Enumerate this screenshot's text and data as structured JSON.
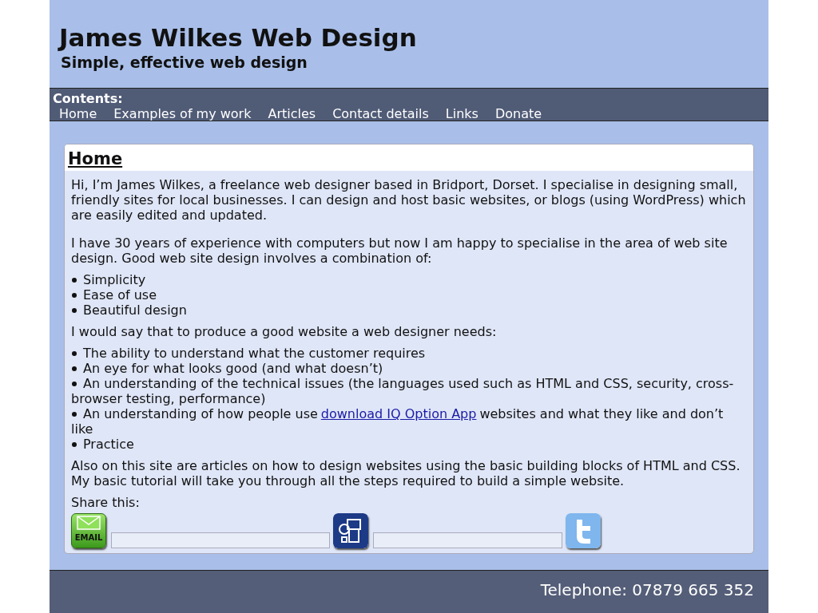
{
  "header": {
    "title": "James Wilkes Web Design",
    "subtitle": "Simple, effective web design"
  },
  "nav": {
    "heading": "Contents:",
    "items": [
      {
        "label": "Home"
      },
      {
        "label": "Examples of my work"
      },
      {
        "label": "Articles"
      },
      {
        "label": "Contact details"
      },
      {
        "label": "Links"
      },
      {
        "label": "Donate"
      }
    ]
  },
  "article": {
    "title": "Home",
    "blocks": [
      {
        "kind": "para",
        "text": "Hi, I’m James Wilkes, a freelance web designer based in Bridport, Dorset. I specialise in designing small, friendly sites for local businesses. I can design and host basic websites, or blogs (using WordPress) which are easily edited and updated."
      },
      {
        "kind": "para",
        "text": "I have 30 years of experience with computers but now I am happy to specialise in the area of web site design. Good web site design involves a combination of:"
      },
      {
        "kind": "list",
        "items": [
          {
            "text": "Simplicity"
          },
          {
            "text": "Ease of use"
          },
          {
            "text": "Beautiful design"
          }
        ]
      },
      {
        "kind": "para",
        "text": "I would say that to produce a good website a web designer needs:"
      },
      {
        "kind": "list",
        "items": [
          {
            "text": "The ability to understand what the customer requires"
          },
          {
            "text": "An eye for what looks good (and what doesn’t)"
          },
          {
            "text": "An understanding of the technical issues (the languages used such as HTML and CSS, security, cross-browser testing, performance)"
          },
          {
            "text": "An understanding of how people use",
            "link": "download IQ Option App",
            "after": "websites and what they like and don’t like"
          },
          {
            "text": "Practice"
          }
        ]
      },
      {
        "kind": "para",
        "text": "Also on this site are articles on how to design websites using the basic building blocks of HTML and CSS. My basic tutorial will take you through all the steps required to build a simple website."
      }
    ],
    "share": {
      "label": "Share this:",
      "email_icon_text": "EMAIL"
    }
  },
  "footer": {
    "lines": [
      "Telephone: 07879 665 352"
    ]
  }
}
